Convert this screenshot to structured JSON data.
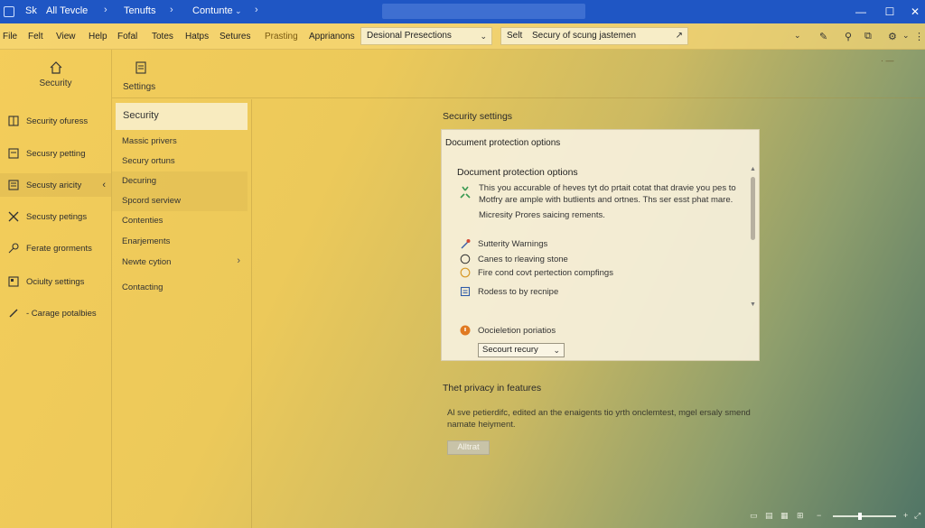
{
  "titlebar": {
    "items": [
      "Sk",
      "All Tevcle",
      "Tenufts",
      "Contunte"
    ],
    "window_buttons": [
      "—",
      "☐",
      "✕"
    ]
  },
  "menubar": {
    "items": [
      "File",
      "Felt",
      "View",
      "Help",
      "Fofal",
      "Totes",
      "Hatps",
      "Setures",
      "Prasting",
      "Apprianons"
    ],
    "active_index": 8,
    "dropdown": {
      "value": "Desional Presections"
    },
    "search": {
      "prefix": "Selt",
      "value": "Secury of scung jastemen"
    }
  },
  "sidebar": {
    "header_label": "Security",
    "items": [
      {
        "label": "Security ofuress"
      },
      {
        "label": "Secusry petting"
      },
      {
        "label": "Secusty aricity"
      },
      {
        "label": "Secusty petings"
      },
      {
        "label": "Ferate grorments"
      },
      {
        "label": "Ociulty settings"
      },
      {
        "label": "- Carage potalbies"
      }
    ],
    "active_index": 2
  },
  "column2": {
    "header_label": "Settings",
    "selected": "Security",
    "items": [
      {
        "label": "Massic privers"
      },
      {
        "label": "Secury ortuns"
      },
      {
        "label": "Decuring"
      },
      {
        "label": "Spcord serview"
      },
      {
        "label": "Contenties"
      },
      {
        "label": "Enarjements"
      },
      {
        "label": "Newte cytion"
      },
      {
        "label": "Contacting"
      }
    ]
  },
  "main": {
    "section_title": "Security settings",
    "panel": {
      "title": "Document protection options",
      "inner_title": "Document protection options",
      "desc_line1": "This you accurable of heves tyt do prtait cotat that dravie you pes to",
      "desc_line2": "Motfry are ample with butlients and ortnes. Ths ser esst phat mare.",
      "desc_line3": "Micresity Prores saicing rements.",
      "options": [
        {
          "label": "Sutterity Warnings"
        },
        {
          "label": "Canes to rleaving stone"
        },
        {
          "label": "Fire cond covt pertection compfings"
        },
        {
          "label": "Rodess to by recnipe"
        },
        {
          "label": "Oocieletion poriatios"
        }
      ],
      "select_value": "Secourt recury"
    },
    "privacy": {
      "title": "Thet privacy in features",
      "text_line1": "Al sve petierdifc, edited an the enaigents tio yrth onclemtest, mgel ersaly smend",
      "text_line2": "namate heiyment.",
      "button_label": "Alltrat"
    }
  },
  "colors": {
    "titlebar": "#1f56c4",
    "accent": "#f4cd5a"
  }
}
